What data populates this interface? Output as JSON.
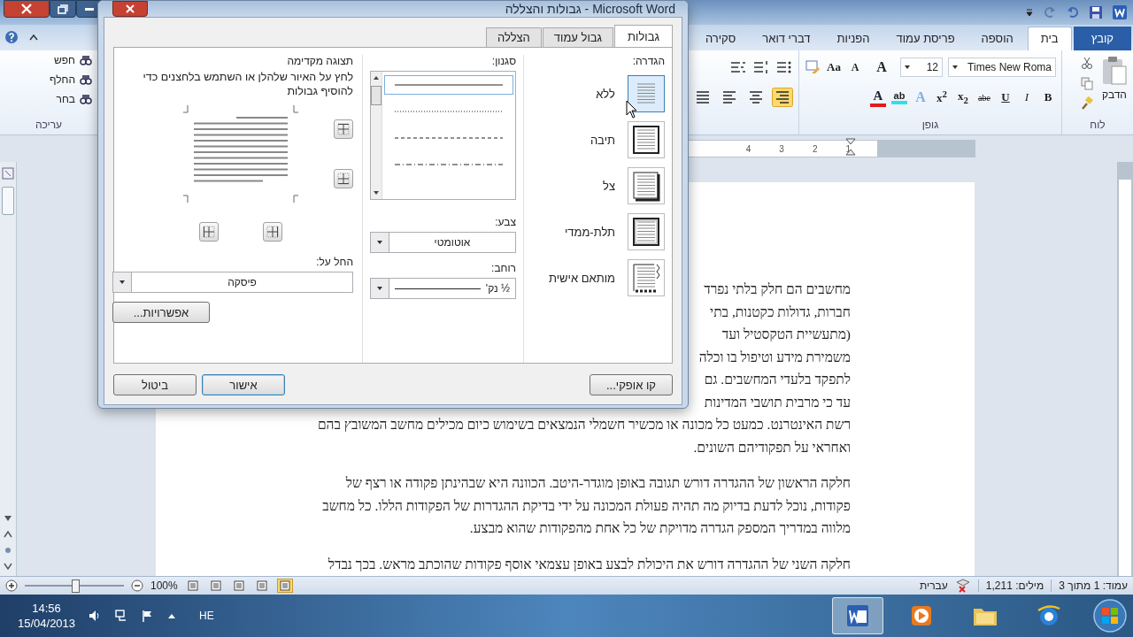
{
  "ribbon": {
    "tabs": [
      {
        "label": "קובץ",
        "kind": "file",
        "selected": false
      },
      {
        "label": "בית",
        "kind": "tab",
        "selected": true
      },
      {
        "label": "הוספה",
        "kind": "tab",
        "selected": false
      },
      {
        "label": "פריסת עמוד",
        "kind": "tab",
        "selected": false
      },
      {
        "label": "הפניות",
        "kind": "tab",
        "selected": false
      },
      {
        "label": "דברי דואר",
        "kind": "tab",
        "selected": false
      },
      {
        "label": "סקירה",
        "kind": "tab",
        "selected": false
      }
    ],
    "clipboard": {
      "paste_label": "הדבק",
      "group_label": "לוח"
    },
    "font": {
      "name": "Times New Roma",
      "size": "12",
      "group_label": "גופן",
      "row1": [
        {
          "label": "A",
          "kind": "grow"
        },
        {
          "label": "A",
          "kind": "shrink"
        },
        {
          "label": "Aa",
          "kind": "case"
        }
      ],
      "row2": [
        {
          "label": "B",
          "kind": "bold"
        },
        {
          "label": "I",
          "kind": "italic"
        },
        {
          "label": "U",
          "kind": "underline"
        },
        {
          "label": "abe",
          "kind": "strike"
        },
        {
          "label": "x$_{2}$",
          "kind": "script"
        },
        {
          "label": "x$^{2}$",
          "kind": "script"
        },
        {
          "label": "A",
          "kind": "effect"
        },
        {
          "label": "ab",
          "kind": "highlight"
        },
        {
          "label": "A",
          "kind": "color"
        }
      ]
    },
    "paragraph": {
      "alignments": [
        {
          "kind": "right",
          "selected": true
        },
        {
          "kind": "center",
          "selected": false
        },
        {
          "kind": "left",
          "selected": false
        },
        {
          "kind": "justify",
          "selected": false
        }
      ]
    },
    "editing": {
      "items": [
        "חפש",
        "החלף",
        "בחר"
      ],
      "group_label": "עריכה"
    }
  },
  "ruler": {
    "numbers": [
      "1",
      "2",
      "3",
      "4"
    ]
  },
  "document": {
    "paragraphs": [
      {
        "lines": [
          "מחשבים הם חלק בלתי נפרד",
          "חברות, גדולות כקטנות, בתי",
          "(מתעשיית הטקסטיל ועד",
          "משמירת מידע וטיפול בו וכלה",
          "לתפקד בלעדי המחשבים. גם",
          "עד כי מרבית תושבי המדינות",
          "רשת האינטרנט. כמעט כל מכונה או מכשיר חשמלי הנמצאים בשימוש כיום מכילים מחשב המשובץ בהם",
          "ואחראי על תפקודיהם השונים."
        ]
      },
      {
        "lines": [
          "חלקה הראשון של ההגדרה דורש תגובה באופן מוגדר-היטב. הכוונה היא שבהינתן פקודה או רצף של",
          "פקודות, נוכל לדעת בדיוק מה תהיה פעולת המכונה על ידי בדיקת ההגדרות של הפקודות הללו. כל מחשב",
          "מלווה במדריך המספק הגדרה מדויקת של כל אחת מהפקודות שהוא מבצע."
        ]
      },
      {
        "lines": [
          "חלקה השני של ההגדרה דורש את היכולת לבצע באופן עצמאי אוסף פקודות שהוכתב מראש. בכך נבדל"
        ]
      }
    ]
  },
  "dialog": {
    "title": "גבולות והצללה - Microsoft Word",
    "tabs": [
      {
        "label": "גבולות",
        "selected": true
      },
      {
        "label": "גבול עמוד",
        "selected": false
      },
      {
        "label": "הצללה",
        "selected": false
      }
    ],
    "setting": {
      "label": "הגדרה:",
      "options": [
        {
          "label": "ללא",
          "kind": "none",
          "selected": true
        },
        {
          "label": "תיבה",
          "kind": "box",
          "selected": false
        },
        {
          "label": "צל",
          "kind": "shadow",
          "selected": false
        },
        {
          "label": "תלת-ממדי",
          "kind": "threed",
          "selected": false
        },
        {
          "label": "מותאם אישית",
          "kind": "custom",
          "selected": false
        }
      ]
    },
    "style": {
      "label": "סגנון:",
      "lines": [
        {
          "kind": "solid",
          "selected": true
        },
        {
          "kind": "dotted",
          "selected": false
        },
        {
          "kind": "dashed",
          "selected": false
        },
        {
          "kind": "dashdot",
          "selected": false
        }
      ]
    },
    "color": {
      "label": "צבע:",
      "value": "אוטומטי"
    },
    "width": {
      "label": "רוחב:",
      "value": "½ נק'"
    },
    "preview": {
      "label": "תצוגה מקדימה",
      "hint": "לחץ על האיור שלהלן או השתמש בלחצנים כדי להוסיף גבולות"
    },
    "apply_to": {
      "label": "החל על:",
      "value": "פיסקה"
    },
    "buttons": [
      {
        "label": "אפשרויות...",
        "kind": "options",
        "default": false
      },
      {
        "label": "קו אופקי...",
        "kind": "horizontal_line",
        "default": false
      },
      {
        "label": "אישור",
        "kind": "ok",
        "default": true
      },
      {
        "label": "ביטול",
        "kind": "cancel",
        "default": false
      }
    ]
  },
  "status_bar": {
    "page": "עמוד: 1 מתוך 3",
    "words": "מילים: 1,211",
    "language": "עברית",
    "zoom": "100%",
    "zoom_slider": {
      "level": 0.5
    },
    "views": [
      {
        "selected": true
      },
      {
        "selected": false
      },
      {
        "selected": false
      },
      {
        "selected": false
      },
      {
        "selected": false
      }
    ]
  },
  "taskbar": {
    "time": "14:56",
    "date": "15/04/2013",
    "language": "HE",
    "apps": [
      {
        "kind": "word",
        "selected": true
      },
      {
        "kind": "media",
        "selected": false
      },
      {
        "kind": "folder",
        "selected": false
      },
      {
        "kind": "browser",
        "selected": false
      }
    ]
  }
}
